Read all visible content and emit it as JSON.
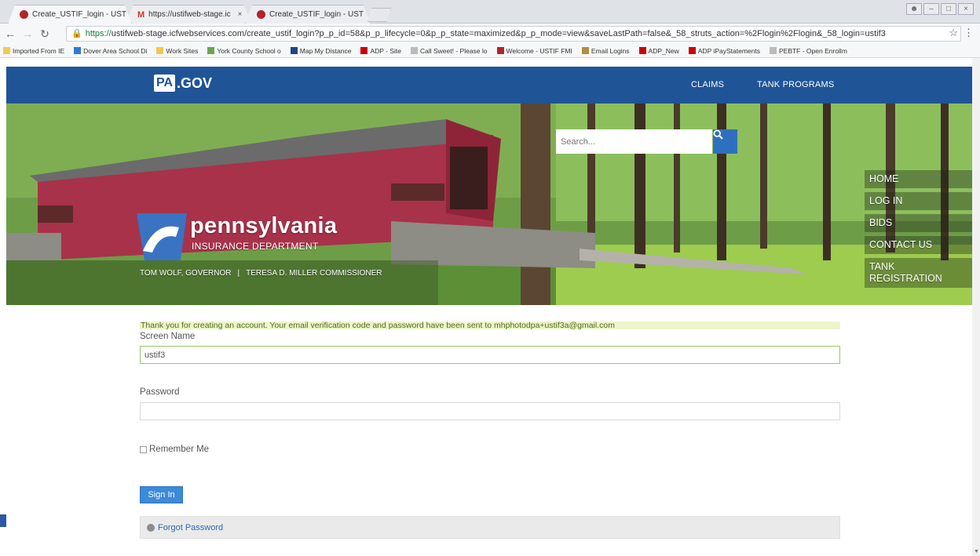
{
  "browser": {
    "tabs": [
      {
        "title": "Create_USTIF_login - UST",
        "icon": "pa-favicon"
      },
      {
        "title": "https://ustifweb-stage.ic",
        "icon": "gmail-icon"
      },
      {
        "title": "Create_USTIF_login - UST",
        "icon": "pa-favicon"
      }
    ],
    "tab_close": "×",
    "url_scheme": "https://",
    "url_rest": "ustifweb-stage.icfwebservices.com/create_ustif_login?p_p_id=58&p_p_lifecycle=0&p_p_state=maximized&p_p_mode=view&saveLastPath=false&_58_struts_action=%2Flogin%2Flogin&_58_login=ustif3",
    "bookmarks": [
      {
        "label": "Imported From IE",
        "color": "#f2c94c"
      },
      {
        "label": "Dover Area School Di",
        "color": "#2d7bd6"
      },
      {
        "label": "Work Sites",
        "color": "#f2c94c"
      },
      {
        "label": "York County School o",
        "color": "#6aa84f"
      },
      {
        "label": "Map My Distance",
        "color": "#1c4587"
      },
      {
        "label": "ADP - Site",
        "color": "#cc0000"
      },
      {
        "label": "Call Sweet! - Please lo",
        "color": "#bbbbbb"
      },
      {
        "label": "Welcome - USTIF FMI",
        "color": "#b0242a"
      },
      {
        "label": "Email Logins",
        "color": "#b58d3c"
      },
      {
        "label": "ADP_New",
        "color": "#cc0000"
      },
      {
        "label": "ADP iPayStatements",
        "color": "#cc0000"
      },
      {
        "label": "PEBTF - Open Enrollm",
        "color": "#bbbbbb"
      }
    ]
  },
  "header": {
    "logo_pa": "PA",
    "logo_gov": ".GOV",
    "nav": [
      {
        "label": "CLAIMS"
      },
      {
        "label": "TANK PROGRAMS"
      }
    ]
  },
  "hero": {
    "search_placeholder": "Search...",
    "brand_name": "pennsylvania",
    "brand_dept": "INSURANCE DEPARTMENT",
    "governor": "TOM WOLF, GOVERNOR",
    "separator": "|",
    "commissioner": "TERESA D. MILLER COMMISSIONER",
    "side_menu": [
      {
        "label": "HOME"
      },
      {
        "label": "LOG IN"
      },
      {
        "label": "BIDS"
      },
      {
        "label": "CONTACT US"
      },
      {
        "label": "TANK REGISTRATION"
      }
    ]
  },
  "form": {
    "notice": "Thank you for creating an account. Your email verification code and password have been sent to mhphotodpa+ustif3a@gmail.com",
    "screen_name_label": "Screen Name",
    "screen_name_value": "ustif3",
    "password_label": "Password",
    "password_value": "",
    "remember_label": "Remember Me",
    "signin_label": "Sign In",
    "forgot_label": "Forgot Password"
  },
  "colors": {
    "nav_blue": "#1f5497",
    "button_blue": "#3c8ad8",
    "notice_bg": "#eef5cc",
    "bridge_red": "#a8324a"
  }
}
